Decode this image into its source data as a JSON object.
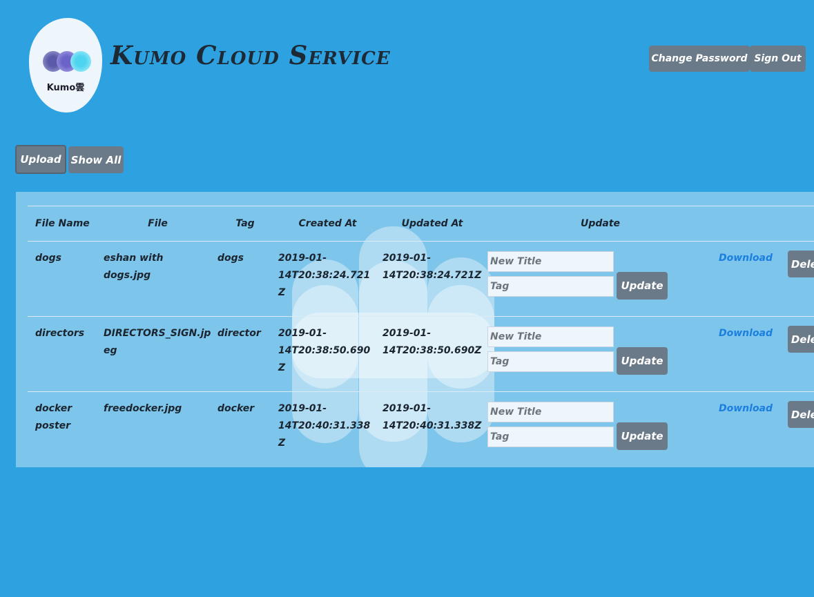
{
  "logo": {
    "text": "Kumo雲"
  },
  "header": {
    "title": "Kumo Cloud Service",
    "change_password_label": "Change Password",
    "sign_out_label": "Sign Out"
  },
  "toolbar": {
    "upload_label": "Upload",
    "show_all_label": "Show All"
  },
  "table": {
    "columns": [
      "File Name",
      "File",
      "Tag",
      "Created At",
      "Updated At",
      "Update"
    ],
    "rows": [
      {
        "file_name": "dogs",
        "file": "eshan with dogs.jpg",
        "tag": "dogs",
        "created_at": "2019-01-14T20:38:24.721Z",
        "updated_at": "2019-01-14T20:38:24.721Z",
        "title_placeholder": "New Title",
        "tag_placeholder": "Tag",
        "update_label": "Update",
        "download_label": "Download",
        "delete_label": "Delete"
      },
      {
        "file_name": "directors",
        "file": "DIRECTORS_SIGN.jpeg",
        "tag": "director",
        "created_at": "2019-01-14T20:38:50.690Z",
        "updated_at": "2019-01-14T20:38:50.690Z",
        "title_placeholder": "New Title",
        "tag_placeholder": "Tag",
        "update_label": "Update",
        "download_label": "Download",
        "delete_label": "Delete"
      },
      {
        "file_name": "docker poster",
        "file": "freedocker.jpg",
        "tag": "docker",
        "created_at": "2019-01-14T20:40:31.338Z",
        "updated_at": "2019-01-14T20:40:31.338Z",
        "title_placeholder": "New Title",
        "tag_placeholder": "Tag",
        "update_label": "Update",
        "download_label": "Download",
        "delete_label": "Delete"
      }
    ]
  },
  "colors": {
    "background": "#2ea2e0",
    "panel": "#7ec5eb",
    "button": "#6b7a88",
    "link": "#1b7fe0"
  }
}
